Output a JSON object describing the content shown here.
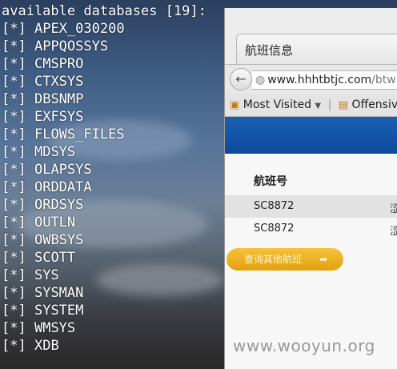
{
  "terminal": {
    "header": "available databases [19]:",
    "prefix": "[*]",
    "items": [
      "APEX_030200",
      "APPQOSSYS",
      "CMSPRO",
      "CTXSYS",
      "DBSNMP",
      "EXFSYS",
      "FLOWS_FILES",
      "MDSYS",
      "OLAPSYS",
      "ORDDATA",
      "ORDSYS",
      "OUTLN",
      "OWBSYS",
      "SCOTT",
      "SYS",
      "SYSMAN",
      "SYSTEM",
      "WMSYS",
      "XDB"
    ]
  },
  "browser": {
    "tab_title": "航班信息",
    "url_host": "www.hhhtbtjc.com",
    "url_path": "/btw",
    "bookmarks": [
      "Most Visited",
      "Offensive S"
    ],
    "table": {
      "header": "航班号",
      "rows": [
        {
          "flight": "SC8872",
          "extra": "涩"
        },
        {
          "flight": "SC8872",
          "extra": "涩"
        }
      ]
    },
    "button_label": "查询其他航班"
  },
  "watermark": "www.wooyun.org"
}
